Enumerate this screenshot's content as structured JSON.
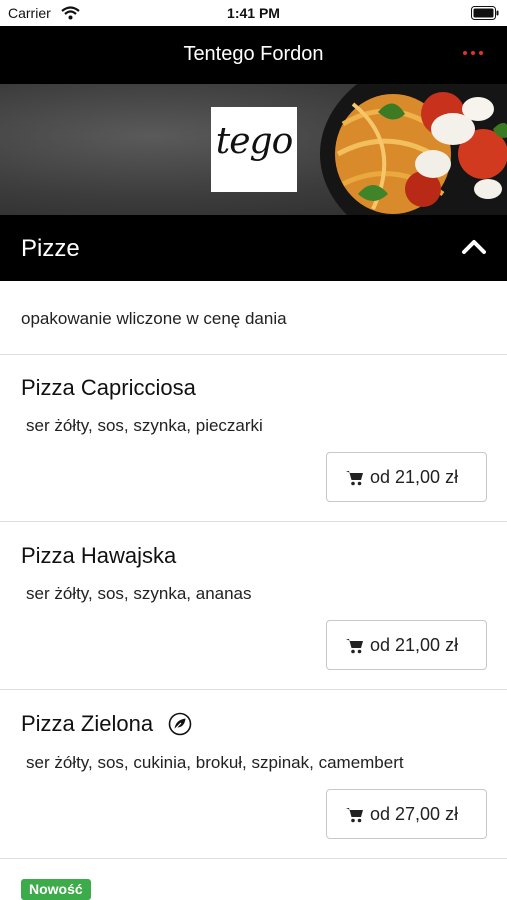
{
  "status_bar": {
    "carrier": "Carrier",
    "time": "1:41 PM"
  },
  "header": {
    "title": "Tentego Fordon",
    "menu_icon": "more-dots-icon"
  },
  "banner": {
    "logo_text": "tego"
  },
  "category": {
    "title": "Pizze",
    "toggle_icon": "chevron-up-icon"
  },
  "note": "opakowanie wliczone w cenę dania",
  "items": [
    {
      "name": "Pizza Capricciosa",
      "description": "ser żółty, sos, szynka, pieczarki",
      "price": "od 21,00 zł",
      "vegetarian": false
    },
    {
      "name": "Pizza Hawajska",
      "description": "ser żółty, sos, szynka, ananas",
      "price": "od 21,00 zł",
      "vegetarian": false
    },
    {
      "name": "Pizza Zielona",
      "description": "ser żółty, sos, cukinia, brokuł, szpinak, camembert",
      "price": "od 27,00 zł",
      "vegetarian": true
    }
  ],
  "badge": {
    "label": "Nowość",
    "color": "#3cab4a"
  },
  "colors": {
    "header_bg": "#000000",
    "accent": "#e0312f"
  }
}
